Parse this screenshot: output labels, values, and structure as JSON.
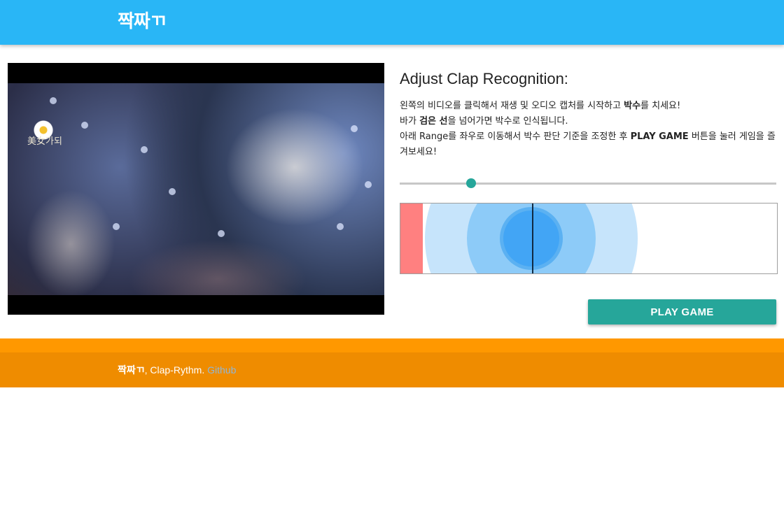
{
  "header": {
    "brand": "짝짜ㄲ"
  },
  "video": {
    "logo_text": "美女가되"
  },
  "panel": {
    "title": "Adjust Clap Recognition:",
    "line1": {
      "a": "왼쪽의 비디오를 클릭해서 재생 및 오디오 캡처를 시작하고 ",
      "b": "박수",
      "c": "를 치세요!"
    },
    "line2": {
      "a": "바가 ",
      "b": "검은 선",
      "c": "을 넘어가면 박수로 인식됩니다."
    },
    "line3": {
      "a": "아래 Range를 좌우로 이동해서 박수 판단 기준을 조정한 후 ",
      "b": "PLAY GAME",
      "c": " 버튼을 눌러 게임을 즐겨보세요!"
    }
  },
  "threshold": {
    "value_fraction": 0.19
  },
  "visualizer": {
    "level_fraction": 0.06,
    "threshold_fraction": 0.35,
    "bar_color": "#ff8080",
    "ring_color": "#42a5f5"
  },
  "actions": {
    "play_label": "PLAY GAME"
  },
  "footer": {
    "brand": "짝짜ㄲ",
    "text": ", Clap-Rythm. ",
    "link": "Github"
  },
  "colors": {
    "nav": "#29b6f6",
    "accent": "#26a69a",
    "footer": "#ff9800"
  }
}
